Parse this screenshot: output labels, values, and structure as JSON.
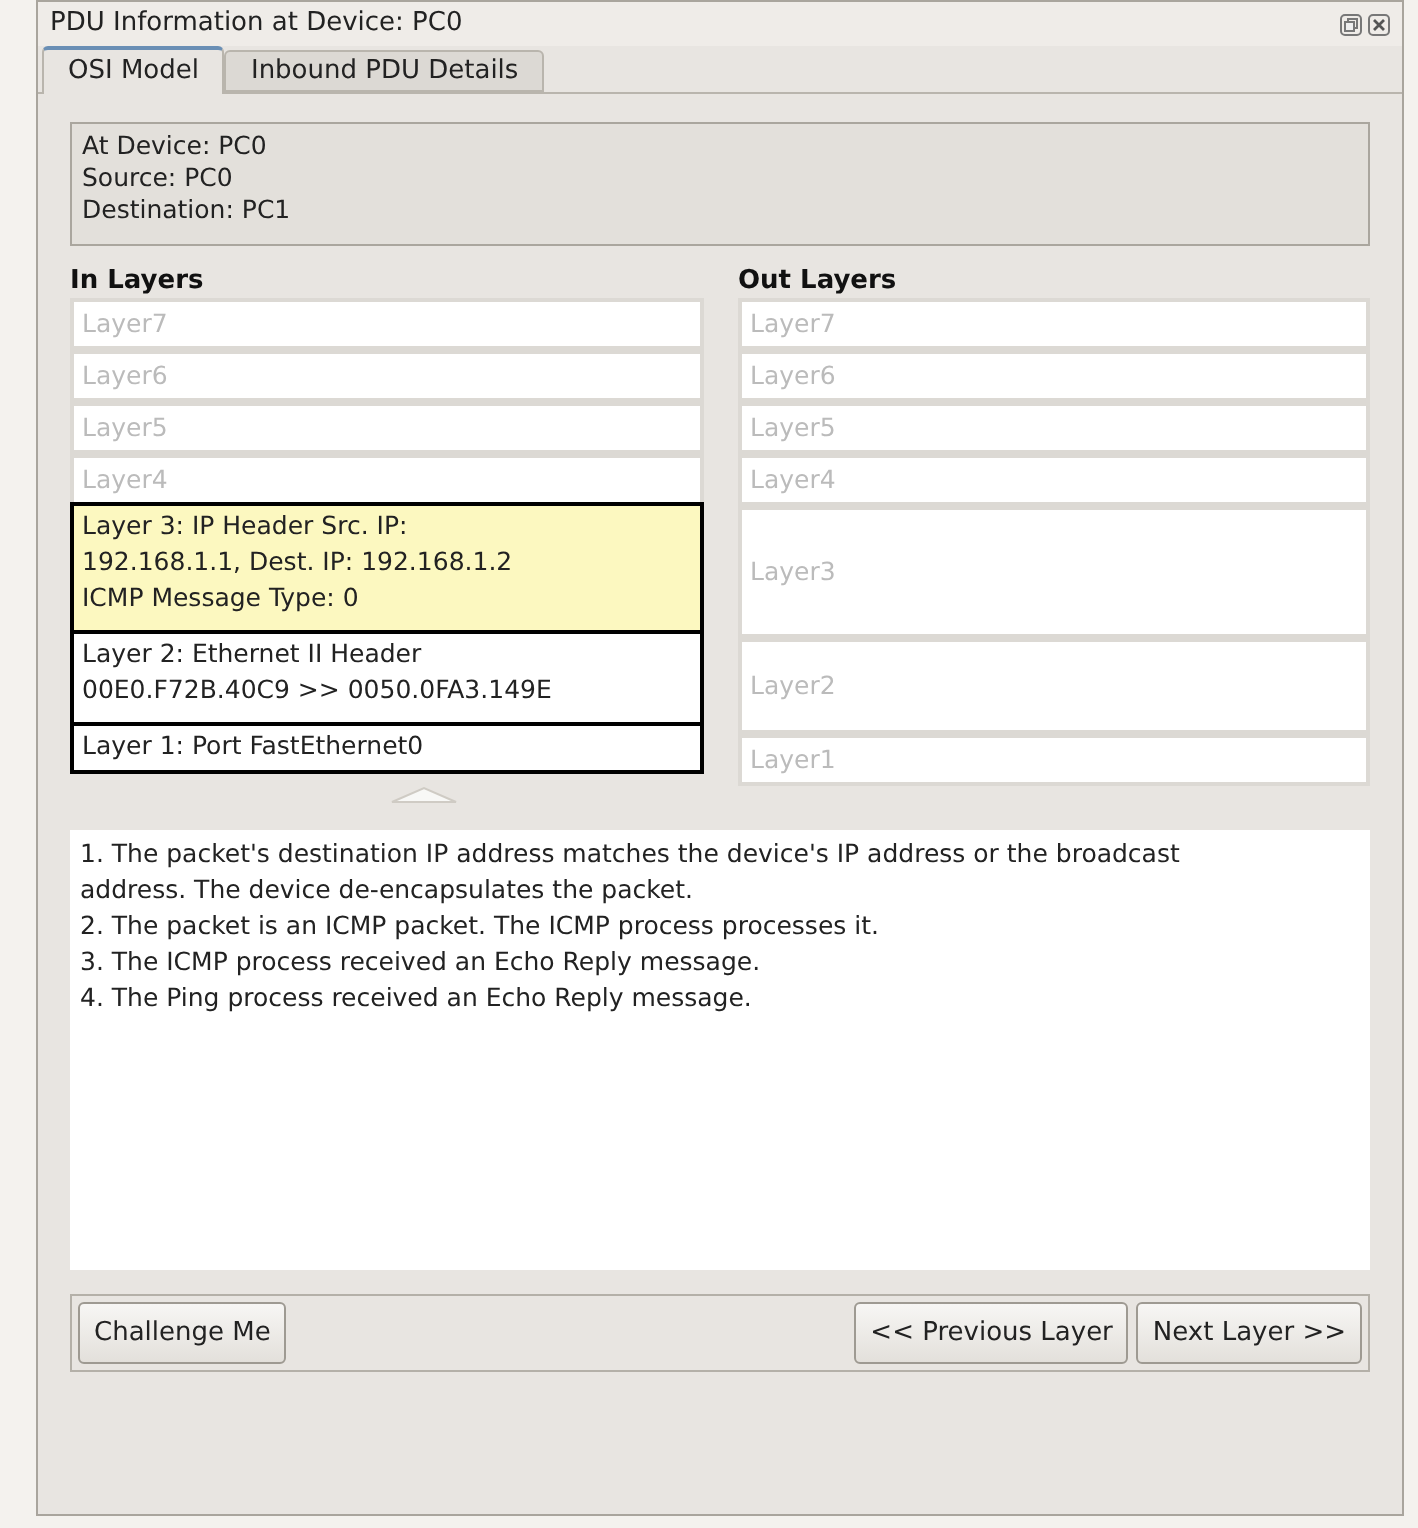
{
  "window": {
    "title": "PDU Information at Device: PC0"
  },
  "tabs": [
    {
      "label": "OSI Model",
      "selected": true
    },
    {
      "label": "Inbound PDU Details",
      "selected": false
    }
  ],
  "info": [
    "At Device: PC0",
    "Source: PC0",
    "Destination: PC1"
  ],
  "in_layers": {
    "heading": "In Layers",
    "items": [
      {
        "text": "Layer7",
        "active": false,
        "selected": false
      },
      {
        "text": "Layer6",
        "active": false,
        "selected": false
      },
      {
        "text": "Layer5",
        "active": false,
        "selected": false
      },
      {
        "text": "Layer4",
        "active": false,
        "selected": false
      },
      {
        "text": "Layer 3: IP Header Src. IP:\n192.168.1.1, Dest. IP: 192.168.1.2\nICMP Message Type: 0",
        "active": true,
        "selected": true
      },
      {
        "text": "Layer 2: Ethernet II Header\n00E0.F72B.40C9 >> 0050.0FA3.149E",
        "active": true,
        "selected": false
      },
      {
        "text": "Layer 1: Port FastEthernet0",
        "active": true,
        "selected": false
      }
    ]
  },
  "out_layers": {
    "heading": "Out Layers",
    "items": [
      {
        "text": "Layer7",
        "active": false,
        "selected": false
      },
      {
        "text": "Layer6",
        "active": false,
        "selected": false
      },
      {
        "text": "Layer5",
        "active": false,
        "selected": false
      },
      {
        "text": "Layer4",
        "active": false,
        "selected": false
      },
      {
        "text": "Layer3",
        "active": false,
        "selected": false
      },
      {
        "text": "Layer2",
        "active": false,
        "selected": false
      },
      {
        "text": "Layer1",
        "active": false,
        "selected": false
      }
    ]
  },
  "description": [
    "1. The packet's destination IP address matches the device's IP address or the broadcast address. The device de-encapsulates the packet.",
    "2. The packet is an ICMP packet. The ICMP process processes it.",
    "3. The ICMP process received an Echo Reply message.",
    "4. The Ping process received an Echo Reply message."
  ],
  "buttons": {
    "left": [
      "Challenge Me"
    ],
    "right": [
      "<< Previous Layer",
      "Next Layer >>"
    ]
  }
}
